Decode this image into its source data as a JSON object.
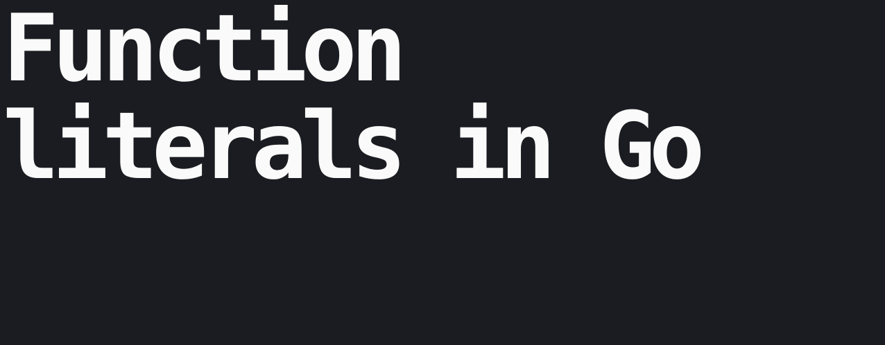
{
  "slide": {
    "title_line_1": "Function",
    "title_line_2": "literals in Go",
    "colors": {
      "background": "#1b1c21",
      "text": "#fafafa"
    }
  }
}
